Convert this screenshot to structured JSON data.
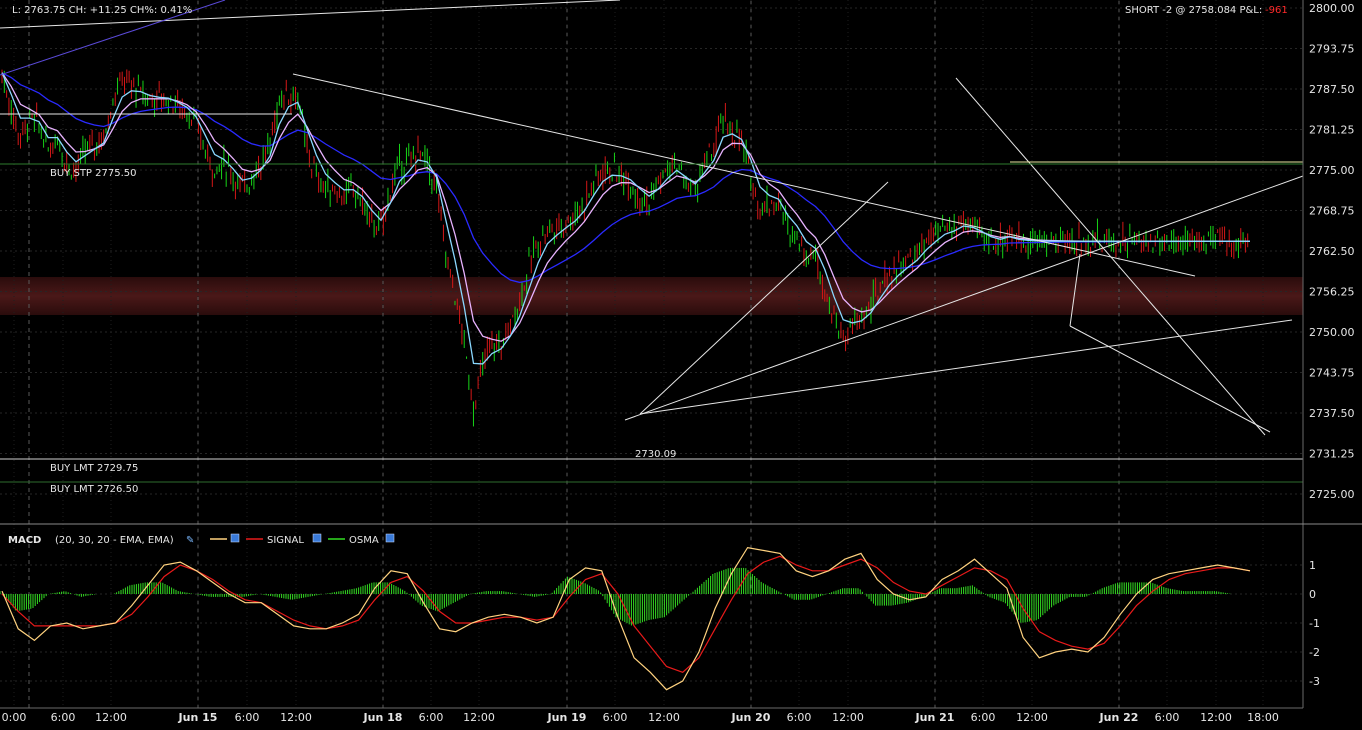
{
  "header": {
    "quote_text": "L: 2763.75 CH: +11.25 CH%: 0.41%",
    "position_text": "SHORT -2 @ 2758.084 P&L: ",
    "pnl_value": "-961"
  },
  "orders": {
    "buy_stp": "BUY STP 2775.50",
    "buy_lmt_1": "BUY LMT 2729.75",
    "buy_lmt_2": "BUY LMT 2726.50"
  },
  "annotations": {
    "low_label": "2730.09"
  },
  "macd_legend": {
    "title": "MACD",
    "params": "(20, 30, 20 - EMA, EMA)",
    "signal_label": "SIGNAL",
    "osma_label": "OSMA"
  },
  "colors": {
    "background": "#000000",
    "up_candle": "#17d417",
    "down_candle": "#d41717",
    "ema_fast": "#8ad8ff",
    "ema_mid": "#e8b3ff",
    "ema_slow": "#2a2aff",
    "macd_line": "#ffd27f",
    "signal_line": "#e81a1a",
    "osma_bars": "#33dd22",
    "zone": "#3a1414"
  },
  "chart_data": [
    {
      "type": "candlestick",
      "instrument_note": "",
      "x_tick_labels": [
        "0:00",
        "6:00",
        "12:00",
        "Jun 15",
        "6:00",
        "12:00",
        "Jun 18",
        "6:00",
        "12:00",
        "Jun 19",
        "6:00",
        "12:00",
        "Jun 20",
        "6:00",
        "12:00",
        "Jun 21",
        "6:00",
        "12:00",
        "Jun 22",
        "6:00",
        "12:00",
        "18:00"
      ],
      "y_tick_labels": [
        "2800.00",
        "2793.75",
        "2787.50",
        "2781.25",
        "2775.00",
        "2768.75",
        "2762.50",
        "2756.25",
        "2750.00",
        "2743.75",
        "2737.50",
        "2731.25",
        "2725.00"
      ],
      "ylim": [
        2721.5,
        2800.0
      ],
      "series": [
        {
          "type": "line",
          "close_path": {
            "x": [
              0,
              0.5,
              1,
              1.5,
              2,
              2.5,
              3,
              3.5,
              4,
              4.5,
              5,
              5.5,
              6,
              6.5,
              7,
              7.5,
              8,
              8.5,
              9,
              9.5,
              10,
              10.5,
              11,
              11.5,
              12,
              12.5,
              13,
              13.5,
              14,
              14.5,
              15,
              15.5,
              16,
              16.5,
              17,
              17.5,
              18,
              18.5,
              19,
              19.5,
              20,
              20.5,
              21,
              21.5,
              22,
              22.5,
              23,
              23.5,
              24,
              24.5,
              25,
              25.5,
              26,
              26.5,
              27,
              27.5,
              28,
              28.5,
              29,
              29.5,
              30,
              30.5,
              31,
              31.5,
              32,
              32.5,
              33,
              33.5,
              34,
              34.5,
              35,
              35.5,
              36,
              36.5,
              37,
              37.5,
              38,
              38.5,
              39,
              39.5,
              40,
              40.5,
              41,
              41.5,
              42,
              42.5,
              43,
              43.5,
              44,
              44.5,
              45,
              45.5,
              46,
              46.5,
              47,
              47.5,
              48,
              48.5,
              49,
              49.5,
              50,
              50.5,
              51,
              51.5,
              52,
              52.5,
              53,
              53.5,
              54,
              54.5,
              55,
              55.5,
              56,
              56.5,
              57,
              57.5,
              58,
              58.5,
              59,
              59.5,
              60,
              60.5,
              61,
              61.5,
              62,
              62.5,
              63,
              63.5,
              64,
              64.5,
              65,
              65.5,
              66,
              66.5,
              67,
              67.5
            ],
            "y": [
              2790,
              2784,
              2780,
              2783,
              2782,
              2778,
              2780,
              2776,
              2775,
              2778,
              2779,
              2780,
              2786,
              2789,
              2788,
              2787,
              2786,
              2786,
              2786,
              2785,
              2784,
              2782,
              2778,
              2775,
              2776,
              2774,
              2772,
              2774,
              2776,
              2779,
              2786,
              2787,
              2786,
              2778,
              2774,
              2772,
              2772,
              2771,
              2772,
              2770,
              2767,
              2766,
              2772,
              2776,
              2776,
              2778,
              2776,
              2772,
              2762,
              2756,
              2748,
              2738,
              2745,
              2748,
              2748,
              2751,
              2755,
              2760,
              2764,
              2766,
              2766,
              2767,
              2768,
              2770,
              2773,
              2775,
              2775,
              2774,
              2773,
              2771,
              2770,
              2773,
              2775,
              2776,
              2773,
              2772,
              2776,
              2778,
              2783,
              2781,
              2779,
              2774,
              2769,
              2770,
              2770,
              2766,
              2765,
              2762,
              2762,
              2757,
              2752,
              2749,
              2751,
              2752,
              2754,
              2757,
              2759,
              2760,
              2761,
              2762,
              2764,
              2765,
              2766,
              2766,
              2767,
              2766,
              2765,
              2764,
              2764,
              2765,
              2764,
              2764,
              2764,
              2764,
              2764,
              2764,
              2764,
              2764,
              2764,
              2764,
              2764,
              2764,
              2764,
              2764,
              2764,
              2764,
              2764,
              2764,
              2764,
              2764,
              2764,
              2764,
              2764,
              2764,
              2764,
              2764
            ]
          }
        }
      ],
      "levels": [
        {
          "price": 2775.5,
          "label": "BUY STP 2775.50"
        },
        {
          "price": 2729.75,
          "label": "BUY LMT 2729.75"
        },
        {
          "price": 2726.5,
          "label": "BUY LMT 2726.50"
        }
      ],
      "zone": {
        "from": 2752.0,
        "to": 2758.0
      },
      "annotation": {
        "price": 2730.09,
        "text": "2730.09"
      },
      "legend_position": "top"
    },
    {
      "type": "macd",
      "title": "MACD",
      "y_tick_labels": [
        "1",
        "0",
        "-1",
        "-2",
        "-3"
      ],
      "ylim": [
        -3.5,
        2.0
      ],
      "params": "(20, 30, 20 - EMA, EMA)",
      "series": [
        {
          "name": "MACD",
          "values": [
            0.1,
            -1.2,
            -1.6,
            -1.1,
            -1.0,
            -1.2,
            -1.1,
            -1.0,
            -0.4,
            0.3,
            1.0,
            1.1,
            0.8,
            0.4,
            0.0,
            -0.3,
            -0.3,
            -0.7,
            -1.1,
            -1.2,
            -1.2,
            -1.0,
            -0.7,
            0.2,
            0.8,
            0.7,
            -0.3,
            -1.2,
            -1.3,
            -1.0,
            -0.8,
            -0.7,
            -0.8,
            -1.0,
            -0.8,
            0.5,
            0.9,
            0.8,
            -0.8,
            -2.2,
            -2.7,
            -3.3,
            -3.0,
            -2.0,
            -0.5,
            0.7,
            1.6,
            1.5,
            1.4,
            0.8,
            0.6,
            0.8,
            1.2,
            1.4,
            0.5,
            0.0,
            -0.2,
            -0.1,
            0.5,
            0.8,
            1.2,
            0.7,
            0.2,
            -1.5,
            -2.2,
            -2.0,
            -1.9,
            -2.0,
            -1.5,
            -0.7,
            0.0,
            0.5,
            0.7,
            0.8,
            0.9,
            1.0,
            0.9,
            0.8
          ]
        },
        {
          "name": "SIGNAL",
          "values": [
            0.0,
            -0.6,
            -1.1,
            -1.1,
            -1.1,
            -1.1,
            -1.1,
            -1.0,
            -0.7,
            -0.1,
            0.6,
            1.0,
            0.8,
            0.5,
            0.1,
            -0.2,
            -0.3,
            -0.6,
            -0.9,
            -1.1,
            -1.2,
            -1.1,
            -0.9,
            -0.2,
            0.4,
            0.6,
            0.1,
            -0.6,
            -1.0,
            -1.0,
            -0.9,
            -0.8,
            -0.8,
            -0.9,
            -0.8,
            -0.1,
            0.5,
            0.7,
            0.0,
            -1.1,
            -1.8,
            -2.5,
            -2.7,
            -2.2,
            -1.2,
            -0.2,
            0.7,
            1.1,
            1.3,
            1.0,
            0.8,
            0.8,
            1.0,
            1.2,
            0.9,
            0.4,
            0.1,
            0.0,
            0.3,
            0.6,
            0.9,
            0.8,
            0.5,
            -0.5,
            -1.3,
            -1.6,
            -1.8,
            -1.9,
            -1.7,
            -1.1,
            -0.4,
            0.1,
            0.5,
            0.7,
            0.8,
            0.9,
            0.9,
            0.8
          ]
        },
        {
          "name": "OSMA",
          "values": [
            0.1,
            -0.6,
            -0.5,
            0.0,
            0.1,
            -0.1,
            0.0,
            0.0,
            0.3,
            0.4,
            0.4,
            0.1,
            0.0,
            -0.1,
            -0.1,
            -0.1,
            0.0,
            -0.1,
            -0.2,
            -0.1,
            0.0,
            0.1,
            0.2,
            0.4,
            0.4,
            0.1,
            -0.4,
            -0.6,
            -0.3,
            0.0,
            0.1,
            0.1,
            0.0,
            -0.1,
            0.0,
            0.6,
            0.4,
            0.1,
            -0.8,
            -1.1,
            -0.9,
            -0.8,
            -0.3,
            0.2,
            0.7,
            0.9,
            0.9,
            0.4,
            0.1,
            -0.2,
            -0.2,
            0.0,
            0.2,
            0.2,
            -0.4,
            -0.4,
            -0.3,
            -0.1,
            0.2,
            0.2,
            0.3,
            -0.1,
            -0.3,
            -1.0,
            -0.9,
            -0.4,
            -0.1,
            -0.1,
            0.2,
            0.4,
            0.4,
            0.4,
            0.2,
            0.1,
            0.1,
            0.1,
            0.0,
            0.0
          ]
        }
      ]
    }
  ]
}
